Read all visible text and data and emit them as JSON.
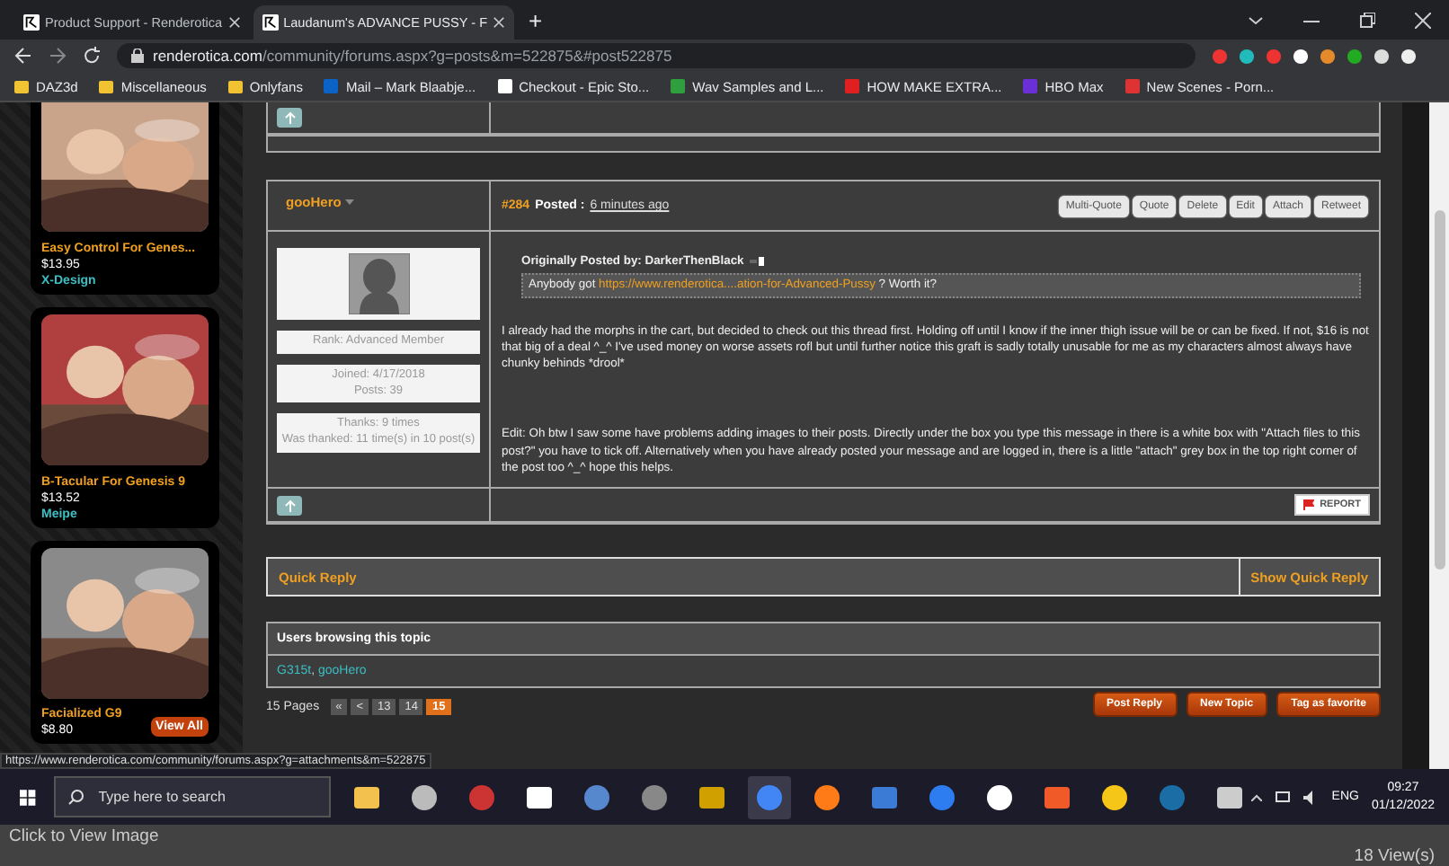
{
  "browser": {
    "tabs": [
      {
        "title": "Product Support - Renderotica",
        "selected": false
      },
      {
        "title": "Laudanum's ADVANCE PUSSY - F",
        "selected": true
      }
    ],
    "new_tab": "+",
    "address": {
      "host": "renderotica.com",
      "path": "/community/forums.aspx?g=posts&m=522875&#post522875"
    },
    "bookmarks": [
      "DAZ3d",
      "Miscellaneous",
      "Onlyfans",
      "Mail – Mark Blaabje...",
      "Checkout - Epic Sto...",
      "Wav Samples and L...",
      "HOW MAKE EXTRA...",
      "HBO Max",
      "New Scenes - Porn..."
    ]
  },
  "sidebar": {
    "products": [
      {
        "title": "Easy Control For Genes...",
        "price": "$13.95",
        "author": "X-Design"
      },
      {
        "title": "B-Tacular For Genesis 9",
        "price": "$13.52",
        "author": "Meipe"
      },
      {
        "title": "Facialized G9",
        "price": "$8.80"
      }
    ],
    "view_all": "View All"
  },
  "post": {
    "user": "gooHero",
    "number": "#284",
    "posted_label": "Posted :",
    "posted_time": "6 minutes ago",
    "actions": [
      "Multi-Quote",
      "Quote",
      "Delete",
      "Edit",
      "Attach",
      "Retweet"
    ],
    "profile": {
      "rank": "Rank: Advanced Member",
      "joined": "Joined: 4/17/2018",
      "posts": "Posts: 39",
      "thanks": "Thanks: 9 times",
      "thanked": "Was thanked: 11 time(s) in 10 post(s)"
    },
    "quote": {
      "header": "Originally Posted by: DarkerThenBlack",
      "text_before": "Anybody got",
      "link": "https://www.renderotica....ation-for-Advanced-Pussy",
      "text_after": "? Worth it?"
    },
    "paragraphs": [
      "I already had the morphs in the cart, but decided to check out this thread first. Holding off until I know if the inner thigh issue will be or can be fixed. If not, $16 is not that big of a deal ^_^ I've used money on worse assets rofl but until further notice this graft is sadly totally unusable for me as my characters almost always have chunky behinds *drool*",
      "Edit: Oh btw I saw some have problems adding images to their posts. Directly under the box you type this message in there is a white box with \"Attach files to this post?\" you have to tick off. Alternatively when you have already posted your message and are logged in, there is a little \"attach\" grey box in the top right corner of the post too ^_^ hope this helps."
    ],
    "report": "REPORT"
  },
  "quick_reply": {
    "title": "Quick Reply",
    "toggle": "Show Quick Reply"
  },
  "browsing": {
    "title": "Users browsing this topic",
    "users": [
      "G315t",
      "gooHero"
    ],
    "separator": ","
  },
  "pagination": {
    "label": "15 Pages",
    "first": "«",
    "prev": "<",
    "pages": [
      {
        "label": "13",
        "selected": false
      },
      {
        "label": "14",
        "selected": false
      },
      {
        "label": "15",
        "selected": true
      }
    ]
  },
  "topic_buttons": [
    "Post Reply",
    "New Topic",
    "Tag as favorite"
  ],
  "status_url": "https://www.renderotica.com/community/forums.aspx?g=attachments&m=522875",
  "taskbar": {
    "search_placeholder": "Type here to search",
    "language": "ENG",
    "time": "09:27",
    "date": "01/12/2022"
  },
  "viewer": {
    "caption": "Click to View Image",
    "views": "18 View(s)"
  }
}
